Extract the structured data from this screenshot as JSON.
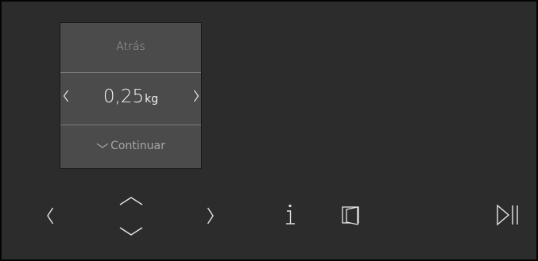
{
  "menu": {
    "back_label": "Atrás",
    "value": "0,25",
    "unit": "kg",
    "continue_label": "Continuar"
  },
  "icons": {
    "value_decrease": "chevron-left-icon",
    "value_increase": "chevron-right-icon",
    "nav_left": "chevron-left-icon",
    "nav_up": "chevron-up-icon",
    "nav_down": "chevron-down-icon",
    "nav_right": "chevron-right-icon",
    "info": "info-icon",
    "door": "door-icon",
    "start_pause": "play-pause-icon"
  },
  "colors": {
    "screen_bg": "#2c2c2c",
    "panel_bg": "#4b4b4b",
    "text_primary": "#f2f2f2",
    "text_secondary": "#a6a6a6"
  }
}
